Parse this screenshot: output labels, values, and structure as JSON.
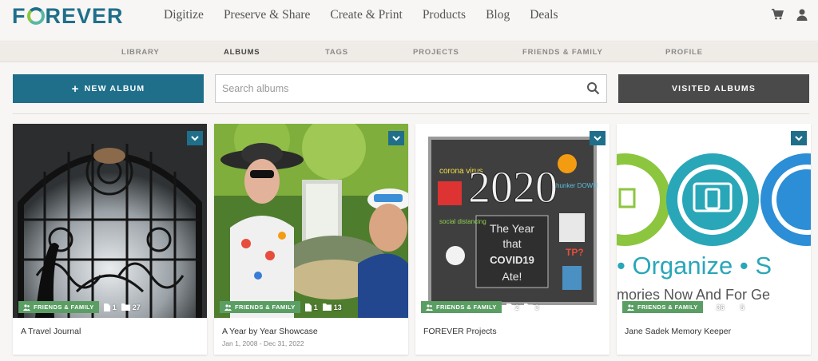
{
  "brand": {
    "logo_text": "FOREVER"
  },
  "main_nav": [
    "Digitize",
    "Preserve & Share",
    "Create & Print",
    "Products",
    "Blog",
    "Deals"
  ],
  "header_icons": [
    "cart-icon",
    "user-icon"
  ],
  "sub_nav": {
    "items": [
      "LIBRARY",
      "ALBUMS",
      "TAGS",
      "PROJECTS",
      "FRIENDS & FAMILY",
      "PROFILE"
    ],
    "active": "ALBUMS"
  },
  "toolbar": {
    "new_album_label": "NEW ALBUM",
    "search_placeholder": "Search albums",
    "visited_label": "VISITED ALBUMS"
  },
  "albums": [
    {
      "title": "A Travel Journal",
      "dates": "",
      "badge": "FRIENDS & FAMILY",
      "files": "1",
      "folders": "27"
    },
    {
      "title": "A Year by Year Showcase",
      "dates": "Jan 1, 2008 - Dec 31, 2022",
      "badge": "FRIENDS & FAMILY",
      "files": "1",
      "folders": "13"
    },
    {
      "title": "FOREVER Projects",
      "dates": "",
      "badge": "FRIENDS & FAMILY",
      "files": "2",
      "folders": "3"
    },
    {
      "title": "Jane Sadek Memory Keeper",
      "dates": "",
      "badge": "FRIENDS & FAMILY",
      "files": "36",
      "folders": "5"
    }
  ],
  "poster": {
    "corona": "corona virus",
    "year": "2020",
    "line1": "The Year",
    "line2": "that",
    "line3": "COVID19",
    "line4": "Ate!",
    "hunker": "hunker DOWN",
    "social": "social distancing",
    "tp": "TP?"
  },
  "banner": {
    "organize": "• Organize • S",
    "memories": "mories Now And For Ge"
  },
  "colors": {
    "brand_blue": "#1f6f8b",
    "dark_button": "#4a4a4a",
    "badge_green": "#5a9e64",
    "teal": "#29a7b8"
  }
}
